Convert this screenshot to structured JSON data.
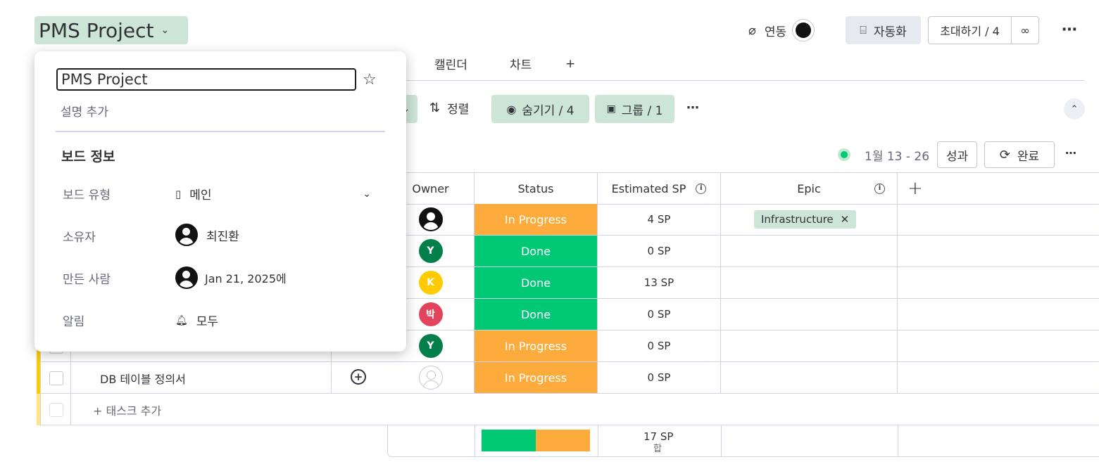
{
  "header": {
    "title": "PMS Project",
    "integrate_label": "연동",
    "automate_label": "자동화",
    "invite_label": "초대하기 / 4"
  },
  "tabs": [
    "캘린더",
    "차트",
    "+"
  ],
  "toolbar": {
    "sort_label": "정렬",
    "hide_label": "숨기기 / 4",
    "group_label": "그룹 / 1"
  },
  "sprint": {
    "range": "1월 13 - 26",
    "performance_label": "성과",
    "complete_label": "완료"
  },
  "table": {
    "columns": [
      "Owner",
      "Status",
      "Estimated SP",
      "Epic"
    ],
    "rows": [
      {
        "owner": "user-icon",
        "status": "In Progress",
        "sp": "4 SP",
        "epic": "Infrastructure"
      },
      {
        "owner": "Y",
        "status": "Done",
        "sp": "0 SP",
        "epic": ""
      },
      {
        "owner": "K",
        "status": "Done",
        "sp": "13 SP",
        "epic": ""
      },
      {
        "owner": "박",
        "status": "Done",
        "sp": "0 SP",
        "epic": ""
      },
      {
        "owner": "Y",
        "status": "In Progress",
        "sp": "0 SP",
        "epic": ""
      },
      {
        "owner": "empty",
        "status": "In Progress",
        "sp": "0 SP",
        "epic": ""
      }
    ],
    "task_name": "DB 테이블 정의서",
    "add_task": "+ 태스크 추가",
    "sum_value": "17 SP",
    "sum_label": "합",
    "progress_done_fraction": 0.5
  },
  "colors": {
    "done": "#00c875",
    "in_progress": "#fdab3d",
    "avatar_y": "#037f4c",
    "avatar_k": "#ffcb00",
    "avatar_park": "#e2445c",
    "group_color": "#ffcb00"
  },
  "popover": {
    "name_value": "PMS Project",
    "description_placeholder": "설명 추가",
    "heading": "보드 정보",
    "board_type_label": "보드 유형",
    "board_type_value": "메인",
    "owner_label": "소유자",
    "owner_value": "최진환",
    "created_label": "만든 사람",
    "created_value": "Jan 21, 2025에",
    "notify_label": "알림",
    "notify_value": "모두"
  }
}
